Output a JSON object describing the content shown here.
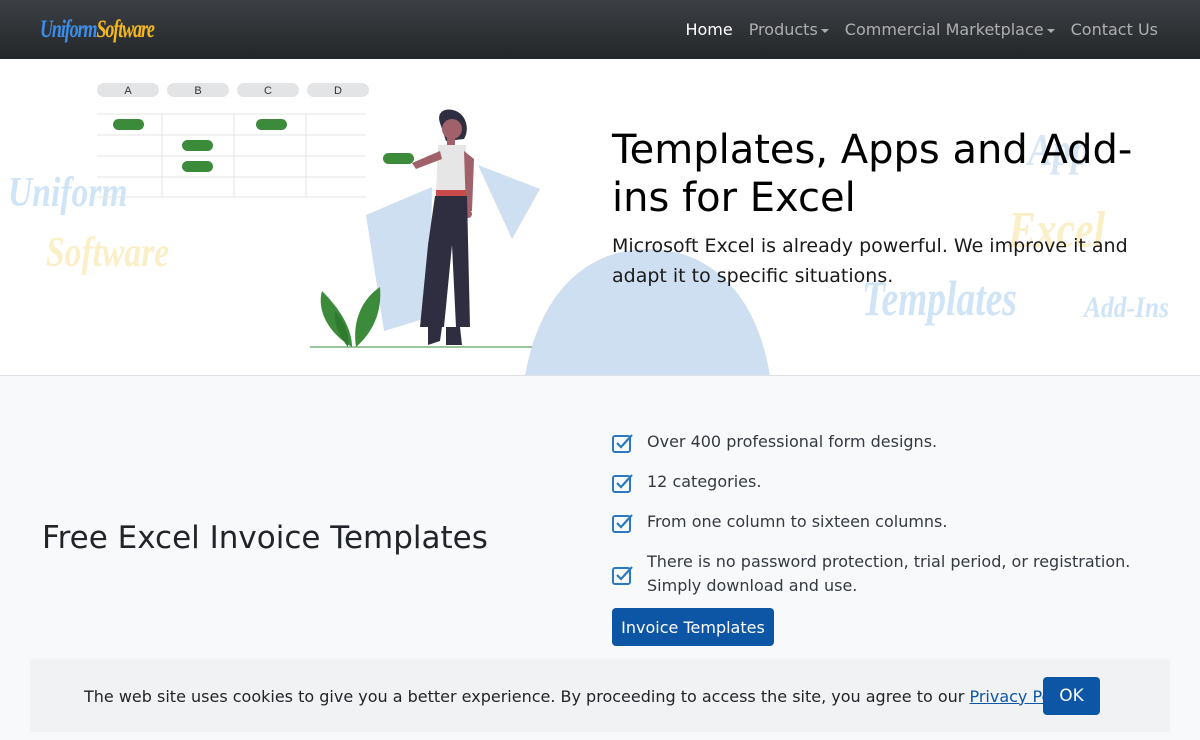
{
  "brand": {
    "part1": "Uniform",
    "part2": "Software"
  },
  "nav": {
    "items": [
      {
        "label": "Home",
        "active": true,
        "dropdown": false
      },
      {
        "label": "Products",
        "active": false,
        "dropdown": true
      },
      {
        "label": "Commercial Marketplace",
        "active": false,
        "dropdown": true
      },
      {
        "label": "Contact Us",
        "active": false,
        "dropdown": false
      }
    ]
  },
  "hero": {
    "title": "Templates, Apps and Add-ins for Excel",
    "text": "Microsoft Excel is already powerful. We improve it and adapt it to specific situations.",
    "watermarks": [
      "Uniform",
      "Software",
      "App",
      "Excel",
      "Templates",
      "Add-Ins"
    ],
    "illustration": {
      "column_headers": [
        "A",
        "B",
        "C",
        "D"
      ]
    }
  },
  "features": {
    "title": "Free Excel Invoice Templates",
    "items": [
      "Over 400 professional form designs.",
      "12 categories.",
      "From one column to sixteen columns.",
      "There is no password protection, trial period, or registration. Simply download and use."
    ],
    "button_label": "Invoice Templates"
  },
  "cookie": {
    "text": "The web site uses cookies to give you a better experience. By proceeding to access the site, you agree to our ",
    "link_label": "Privacy Policy",
    "suffix": ".",
    "ok_label": "OK"
  },
  "colors": {
    "primary": "#0d56a6",
    "accent_green": "#3b8b3a",
    "navbar": "#2f3236",
    "light_blue": "#cddff0"
  }
}
